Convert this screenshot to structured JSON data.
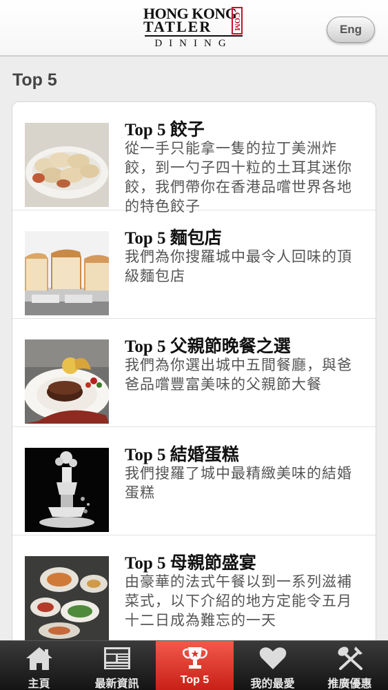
{
  "header": {
    "logo": {
      "line1": "HONG KONG",
      "line2": "TATLER",
      "com": ".COM",
      "line3": "DINING"
    },
    "lang_button": "Eng"
  },
  "page_title": "Top 5",
  "items": [
    {
      "title": "Top 5 餃子",
      "desc": "從一手只能拿一隻的拉丁美洲炸餃，到一勺子四十粒的土耳其迷你餃，我們帶你在香港品嚐世界各地的特色餃子",
      "thumb": "dumplings-photo"
    },
    {
      "title": "Top 5 麵包店",
      "desc": "我們為你搜羅城中最令人回味的頂級麵包店",
      "thumb": "bread-photo"
    },
    {
      "title": "Top 5 父親節晚餐之選",
      "desc": "我們為你選出城中五間餐廳，與爸爸品嚐豐富美味的父親節大餐",
      "thumb": "steak-dinner-photo"
    },
    {
      "title": "Top 5 結婚蛋糕",
      "desc": "我們搜羅了城中最精緻美味的結婚蛋糕",
      "thumb": "wedding-cake-photo"
    },
    {
      "title": "Top 5 母親節盛宴",
      "desc": "由豪華的法式午餐以到一系列滋補菜式，以下介紹的地方定能令五月十二日成為難忘的一天",
      "thumb": "feast-photo"
    }
  ],
  "tabs": [
    {
      "label": "主頁",
      "icon": "home-icon",
      "active": false
    },
    {
      "label": "最新資訊",
      "icon": "newspaper-icon",
      "active": false
    },
    {
      "label": "Top 5",
      "icon": "trophy-icon",
      "active": true
    },
    {
      "label": "我的最愛",
      "icon": "heart-icon",
      "active": false
    },
    {
      "label": "推廣優惠",
      "icon": "fork-spoon-icon",
      "active": false
    }
  ],
  "colors": {
    "accent": "#d9352a",
    "brand_red": "#c8102e",
    "tabbar": "#1e1e1e"
  }
}
